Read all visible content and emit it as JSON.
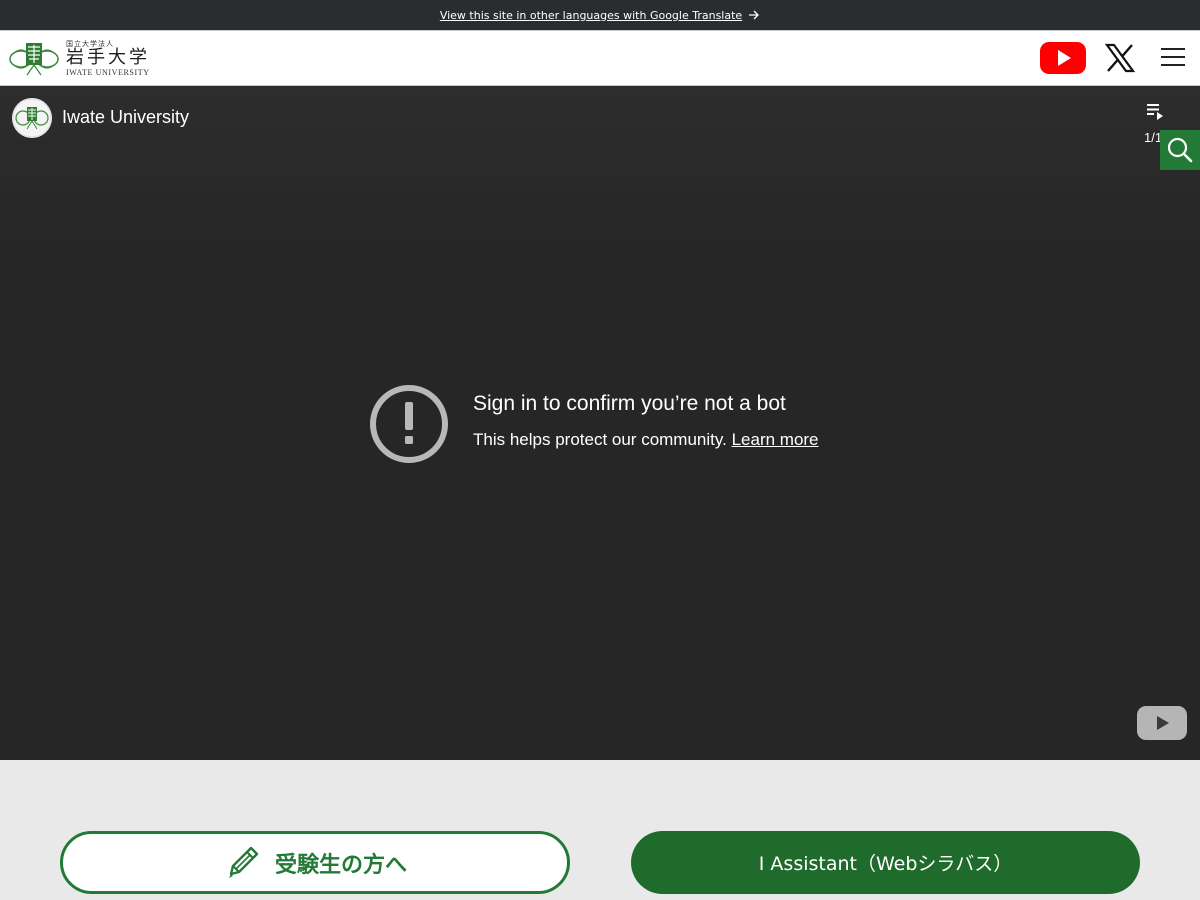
{
  "translate_bar": {
    "link_text": "View this site in other languages with Google Translate",
    "arrow_icon": "arrow-right-icon"
  },
  "header": {
    "logo": {
      "sub": "国立大学法人",
      "main": "岩手大学",
      "en": "IWATE UNIVERSITY"
    },
    "icons": [
      "youtube-icon",
      "x-icon",
      "hamburger-menu-icon"
    ],
    "colors": {
      "youtube_red": "#ff0000",
      "brand_green": "#237a36"
    }
  },
  "video": {
    "channel_title": "Iwate University",
    "playlist_count": "1/1",
    "error_title": "Sign in to confirm you’re not a bot",
    "error_text": "This helps protect our community.",
    "learn_more": "Learn more"
  },
  "search": {
    "icon": "search-icon"
  },
  "buttons": {
    "applicants": "受験生の方へ",
    "assistant": "I Assistant（Webシラバス）"
  }
}
